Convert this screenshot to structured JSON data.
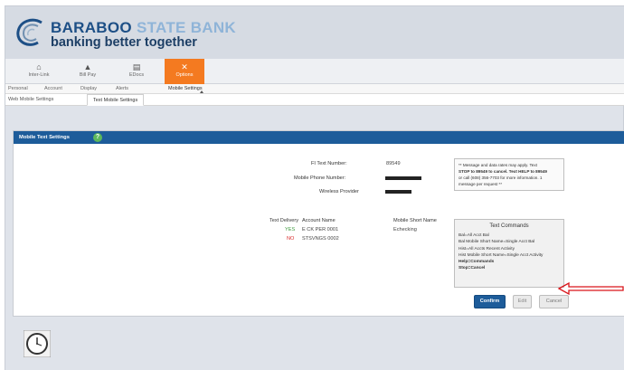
{
  "brand": {
    "name_part1": "BARABOO",
    "name_part2": "STATE BANK",
    "tagline": "banking better together"
  },
  "top_nav": [
    {
      "label": "Inter-Link",
      "icon": "home-icon",
      "active": false
    },
    {
      "label": "Bill Pay",
      "icon": "bank-icon",
      "active": false
    },
    {
      "label": "EDocs",
      "icon": "document-icon",
      "active": false
    },
    {
      "label": "Options",
      "icon": "tools-icon",
      "active": true
    }
  ],
  "sub_nav": [
    "Personal",
    "Account",
    "Display",
    "Alerts",
    "Mobile Settings"
  ],
  "sub_nav_selected": "Mobile Settings",
  "sub_tabs": [
    "Web Mobile Settings",
    "Text Mobile Settings"
  ],
  "sub_tab_selected": "Text Mobile Settings",
  "panel": {
    "title": "Mobile Text Settings",
    "help_glyph": "?",
    "fi_label": "FI Text Number:",
    "fi_value": "89549",
    "phone_label": "Mobile Phone Number:",
    "provider_label": "Wireless Provider",
    "note_lines": [
      "** Message and data rates may apply. Text",
      "STOP to 89549 to cancel. Text HELP to 89549",
      "or call (608) 356-7703 for more information. 1",
      "message per request **"
    ],
    "table_headers": [
      "Text Delivery",
      "Account Name",
      "Mobile Short Name"
    ],
    "rows": [
      {
        "delivery": "YES",
        "account": "E CK PER 0001",
        "short": "Echecking"
      },
      {
        "delivery": "NO",
        "account": "STSVNGS 0002",
        "short": ""
      }
    ],
    "commands_title": "Text Commands",
    "commands": [
      "Bal=All Acct Bal",
      "Bal Mobile Short Name=Single Acct Bal",
      "Hist=All Accts Recent Activity",
      "Hist Mobile Short Name=Single Acct Activity",
      "Help=Commands",
      "Stop=Cancel"
    ],
    "buttons": {
      "confirm": "Confirm",
      "edit": "Edit",
      "cancel": "Cancel"
    }
  },
  "colors": {
    "brand_blue": "#1d5c9a",
    "active_tab_orange": "#f47a20",
    "annotation_arrow": "#d9151b"
  }
}
